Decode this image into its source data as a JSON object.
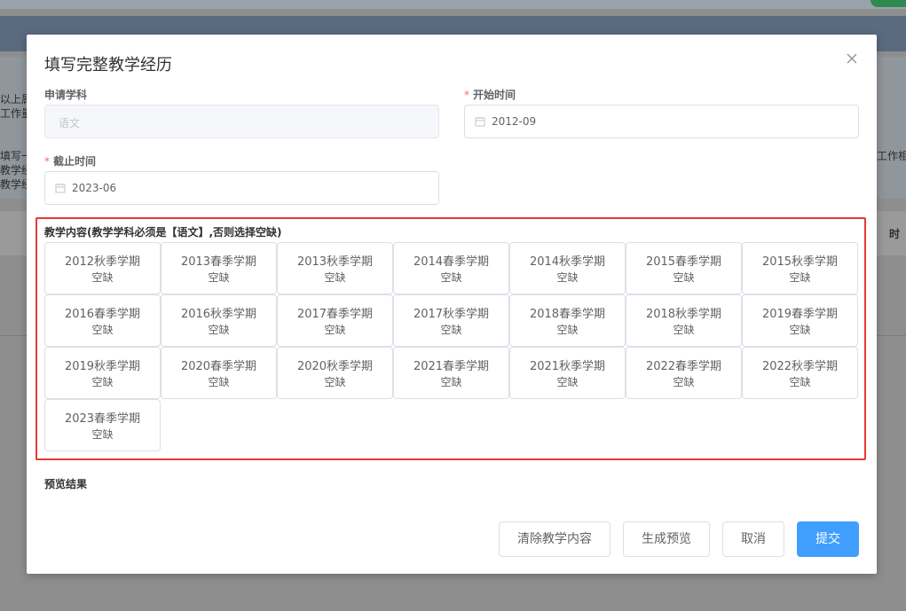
{
  "background": {
    "fragments": [
      "以上属",
      "工作量",
      "填写一",
      "教学经",
      "教学经",
      "工作相",
      "时"
    ]
  },
  "dialog": {
    "title": "填写完整教学经历",
    "close_icon": "close-icon"
  },
  "form": {
    "subject": {
      "label": "申请学科",
      "placeholder": "语文",
      "required": false,
      "disabled": true
    },
    "start_time": {
      "label": "开始时间",
      "value": "2012-09",
      "required": true,
      "icon": "calendar-icon"
    },
    "end_time": {
      "label": "截止时间",
      "value": "2023-06",
      "required": true,
      "icon": "calendar-icon"
    },
    "required_mark": "*"
  },
  "teaching": {
    "label": "教学内容(教学学科必须是【语文】,否则选择空缺)",
    "highlight_color": "#e53935",
    "terms": [
      {
        "term": "2012秋季学期",
        "status": "空缺"
      },
      {
        "term": "2013春季学期",
        "status": "空缺"
      },
      {
        "term": "2013秋季学期",
        "status": "空缺"
      },
      {
        "term": "2014春季学期",
        "status": "空缺"
      },
      {
        "term": "2014秋季学期",
        "status": "空缺"
      },
      {
        "term": "2015春季学期",
        "status": "空缺"
      },
      {
        "term": "2015秋季学期",
        "status": "空缺"
      },
      {
        "term": "2016春季学期",
        "status": "空缺"
      },
      {
        "term": "2016秋季学期",
        "status": "空缺"
      },
      {
        "term": "2017春季学期",
        "status": "空缺"
      },
      {
        "term": "2017秋季学期",
        "status": "空缺"
      },
      {
        "term": "2018春季学期",
        "status": "空缺"
      },
      {
        "term": "2018秋季学期",
        "status": "空缺"
      },
      {
        "term": "2019春季学期",
        "status": "空缺"
      },
      {
        "term": "2019秋季学期",
        "status": "空缺"
      },
      {
        "term": "2020春季学期",
        "status": "空缺"
      },
      {
        "term": "2020秋季学期",
        "status": "空缺"
      },
      {
        "term": "2021春季学期",
        "status": "空缺"
      },
      {
        "term": "2021秋季学期",
        "status": "空缺"
      },
      {
        "term": "2022春季学期",
        "status": "空缺"
      },
      {
        "term": "2022秋季学期",
        "status": "空缺"
      },
      {
        "term": "2023春季学期",
        "status": "空缺"
      }
    ]
  },
  "preview": {
    "label": "预览结果"
  },
  "buttons": {
    "clear": "清除教学内容",
    "preview": "生成预览",
    "cancel": "取消",
    "submit": "提交"
  },
  "colors": {
    "primary": "#409eff",
    "required": "#f56c6c",
    "border": "#dcdfe6"
  }
}
